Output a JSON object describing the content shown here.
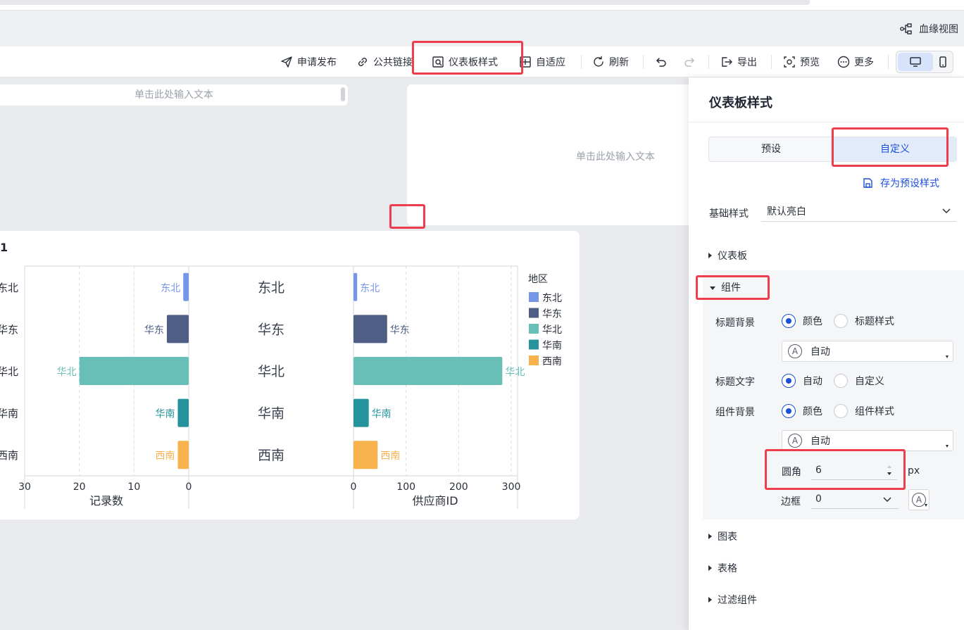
{
  "header": {
    "lineage_label": "血缘视图"
  },
  "toolbar": {
    "apply_publish": "申请发布",
    "public_link": "公共链接",
    "dashboard_style": "仪表板样式",
    "adaptive": "自适应",
    "refresh": "刷新",
    "export": "导出",
    "preview": "预览",
    "more": "更多"
  },
  "canvas": {
    "textbox1_placeholder": "单击此处输入文本",
    "textbox2_placeholder": "单击此处输入文本",
    "chart_title": "1"
  },
  "chart_data": {
    "type": "bar",
    "orientation": "horizontal",
    "title": "1",
    "categories": [
      "东北",
      "华东",
      "华北",
      "华南",
      "西南"
    ],
    "series": [
      {
        "name": "记录数",
        "values": [
          1,
          4,
          20,
          2,
          2
        ]
      },
      {
        "name": "供应商ID",
        "values": [
          7,
          64,
          283,
          29,
          46
        ]
      }
    ],
    "left_axis": {
      "label": "记录数",
      "ticks": [
        "30",
        "20",
        "10",
        "0"
      ],
      "range": [
        0,
        30
      ]
    },
    "right_axis": {
      "label": "供应商ID",
      "ticks": [
        "0",
        "100",
        "200",
        "300"
      ],
      "range": [
        0,
        300
      ]
    },
    "legend": {
      "title": "地区",
      "placement": "right",
      "entries": [
        "东北",
        "华东",
        "华北",
        "华南",
        "西南"
      ]
    },
    "colors": {
      "东北": "#7896e8",
      "华东": "#4e5e84",
      "华北": "#67bfb8",
      "华南": "#24939c",
      "西南": "#f7b24e"
    },
    "grid": true
  },
  "panel": {
    "title": "仪表板样式",
    "tabs": [
      "预设",
      "自定义"
    ],
    "active_tab": "自定义",
    "save_preset": "存为预设样式",
    "base_style_label": "基础样式",
    "base_style_value": "默认亮白",
    "sections": {
      "dashboard": "仪表板",
      "component": "组件",
      "chart": "图表",
      "table": "表格",
      "filter": "过滤组件"
    },
    "component": {
      "title_bg_label": "标题背景",
      "title_bg_opt1": "颜色",
      "title_bg_opt2": "标题样式",
      "title_bg_select": "自动",
      "title_text_label": "标题文字",
      "title_text_opt1": "自动",
      "title_text_opt2": "自定义",
      "comp_bg_label": "组件背景",
      "comp_bg_opt1": "颜色",
      "comp_bg_opt2": "组件样式",
      "comp_bg_select": "自动",
      "radius_label": "圆角",
      "radius_value": "6",
      "radius_unit": "px",
      "border_label": "边框",
      "border_value": "0"
    }
  },
  "accent_color": "#1c4fd8",
  "highlight_color": "#ee3d4d"
}
